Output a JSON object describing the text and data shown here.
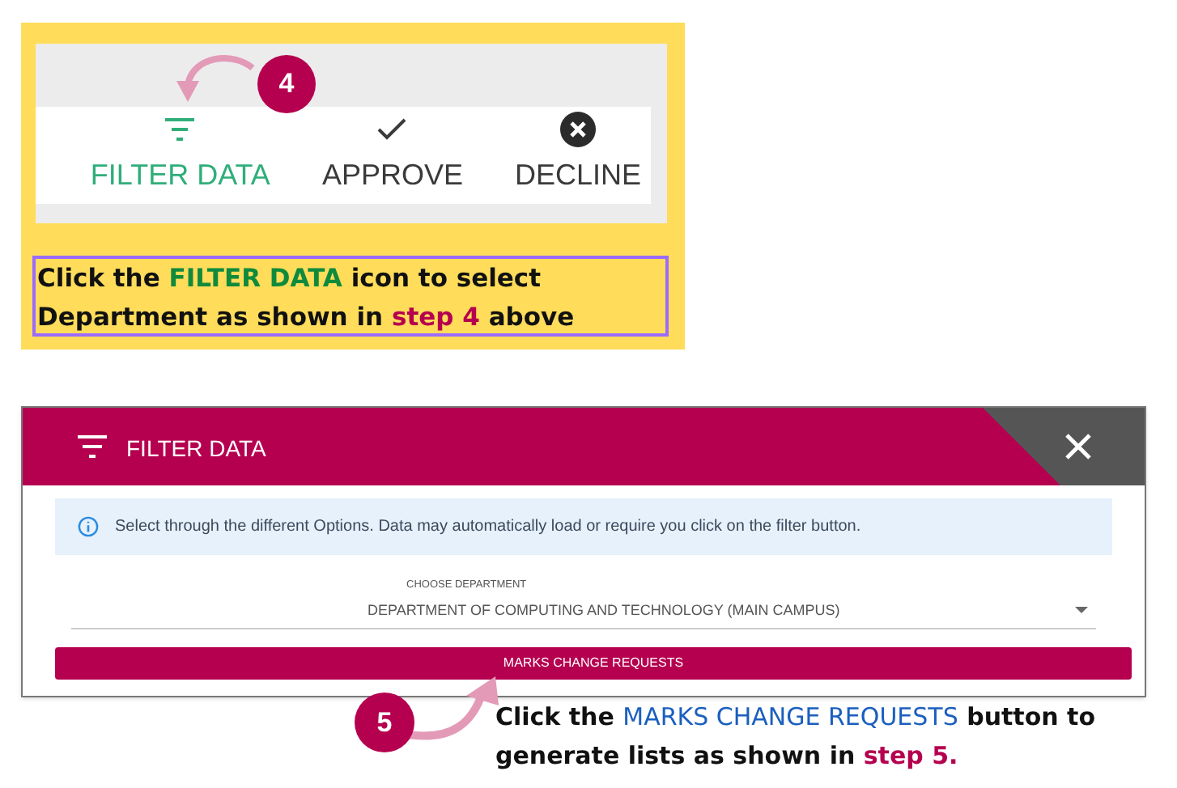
{
  "step_4": {
    "badge": "4",
    "toolbar": [
      {
        "kind": "filter",
        "label": "FILTER DATA",
        "selected": true
      },
      {
        "kind": "check",
        "label": "APPROVE",
        "selected": false
      },
      {
        "kind": "close",
        "label": "DECLINE",
        "selected": false
      }
    ],
    "caption": [
      {
        "kind": "plain",
        "text": "Click the "
      },
      {
        "kind": "accent",
        "text": "FILTER DATA"
      },
      {
        "kind": "plain",
        "text": " icon to select Department as shown in "
      },
      {
        "kind": "step",
        "text": "step 4"
      },
      {
        "kind": "plain",
        "text": " above"
      }
    ]
  },
  "step_5": {
    "dialog": {
      "title": "FILTER DATA",
      "info": "Select through the different Options. Data may automatically load or require you click on the filter button.",
      "select_label": "CHOOSE DEPARTMENT",
      "select_value": "DEPARTMENT OF COMPUTING AND TECHNOLOGY (MAIN CAMPUS)",
      "button": "MARKS CHANGE REQUESTS"
    },
    "badge": "5",
    "caption": [
      {
        "kind": "plain",
        "text": "Click the "
      },
      {
        "kind": "link",
        "text": "MARKS CHANGE REQUESTS"
      },
      {
        "kind": "plain",
        "text": " button to generate lists as shown in "
      },
      {
        "kind": "step",
        "text": "step 5."
      }
    ]
  }
}
